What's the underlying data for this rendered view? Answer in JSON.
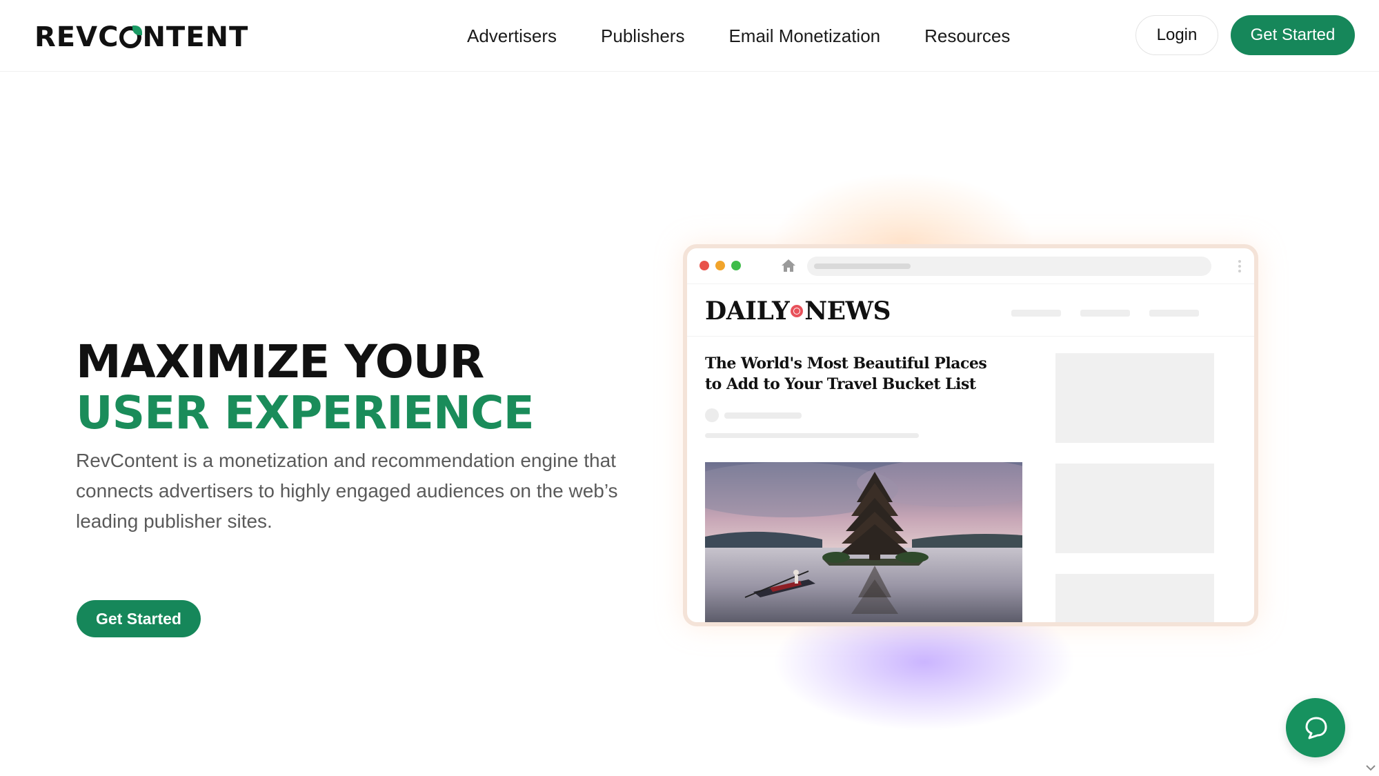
{
  "brand": {
    "logo_pre": "REVC",
    "logo_post": "NTENT",
    "accent": "#16875a"
  },
  "nav": {
    "items": [
      {
        "label": "Advertisers"
      },
      {
        "label": "Publishers"
      },
      {
        "label": "Email Monetization"
      },
      {
        "label": "Resources"
      }
    ]
  },
  "header": {
    "login_label": "Login",
    "cta_label": "Get Started"
  },
  "hero": {
    "title_line1": "MAXIMIZE YOUR",
    "title_line2": "USER EXPERIENCE",
    "description": "RevContent is a monetization and recommendation engine that connects advertisers to highly engaged audiences on the web’s leading publisher sites.",
    "cta_label": "Get Started"
  },
  "mockup": {
    "site_name_left": "DAILY",
    "site_name_right": "NEWS",
    "article_title": "The World's Most Beautiful Places to Add to Your Travel Bucket List",
    "image_subject": "temple-lake-boat"
  },
  "icons": {
    "home": "home-icon",
    "kebab": "kebab-menu-icon",
    "chat": "chat-bubble-icon",
    "scroll": "chevron-down-icon"
  }
}
